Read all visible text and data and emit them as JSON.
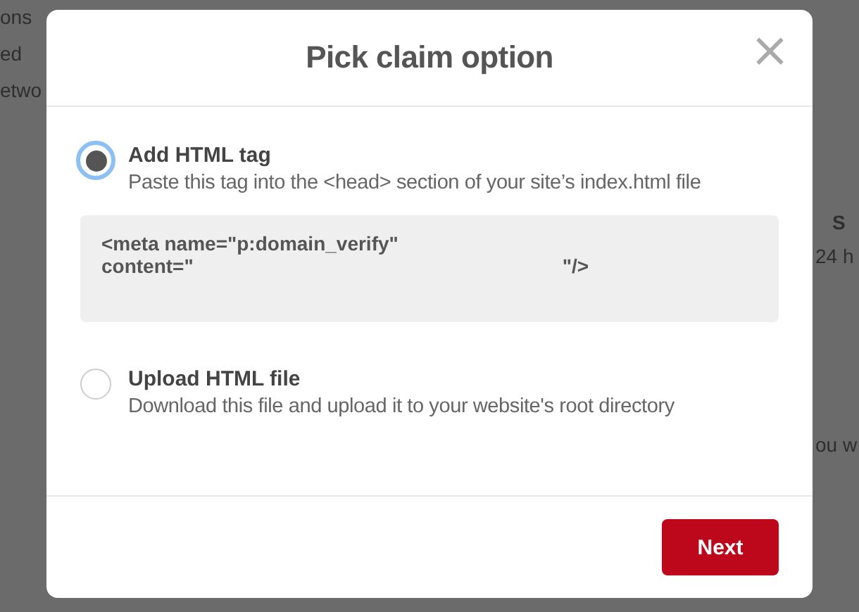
{
  "background": {
    "left_texts": [
      "ons",
      "ed",
      "etwo"
    ],
    "right_texts": [
      "S",
      "24 h",
      "ou w"
    ]
  },
  "dialog": {
    "title": "Pick claim option",
    "close": "×",
    "options": [
      {
        "kind": "tag",
        "label": "Add HTML tag",
        "description": "Paste this tag into the <head> section of your site’s index.html file",
        "selected": true,
        "code": {
          "line_1": "<meta name=\"p:domain_verify\"",
          "line_2_start": "content=\"",
          "line_2_end": "\"/>"
        }
      },
      {
        "kind": "file",
        "label": "Upload HTML file",
        "description": "Download this file and upload it to your website's root directory",
        "selected": false
      }
    ],
    "next_button": "Next"
  }
}
